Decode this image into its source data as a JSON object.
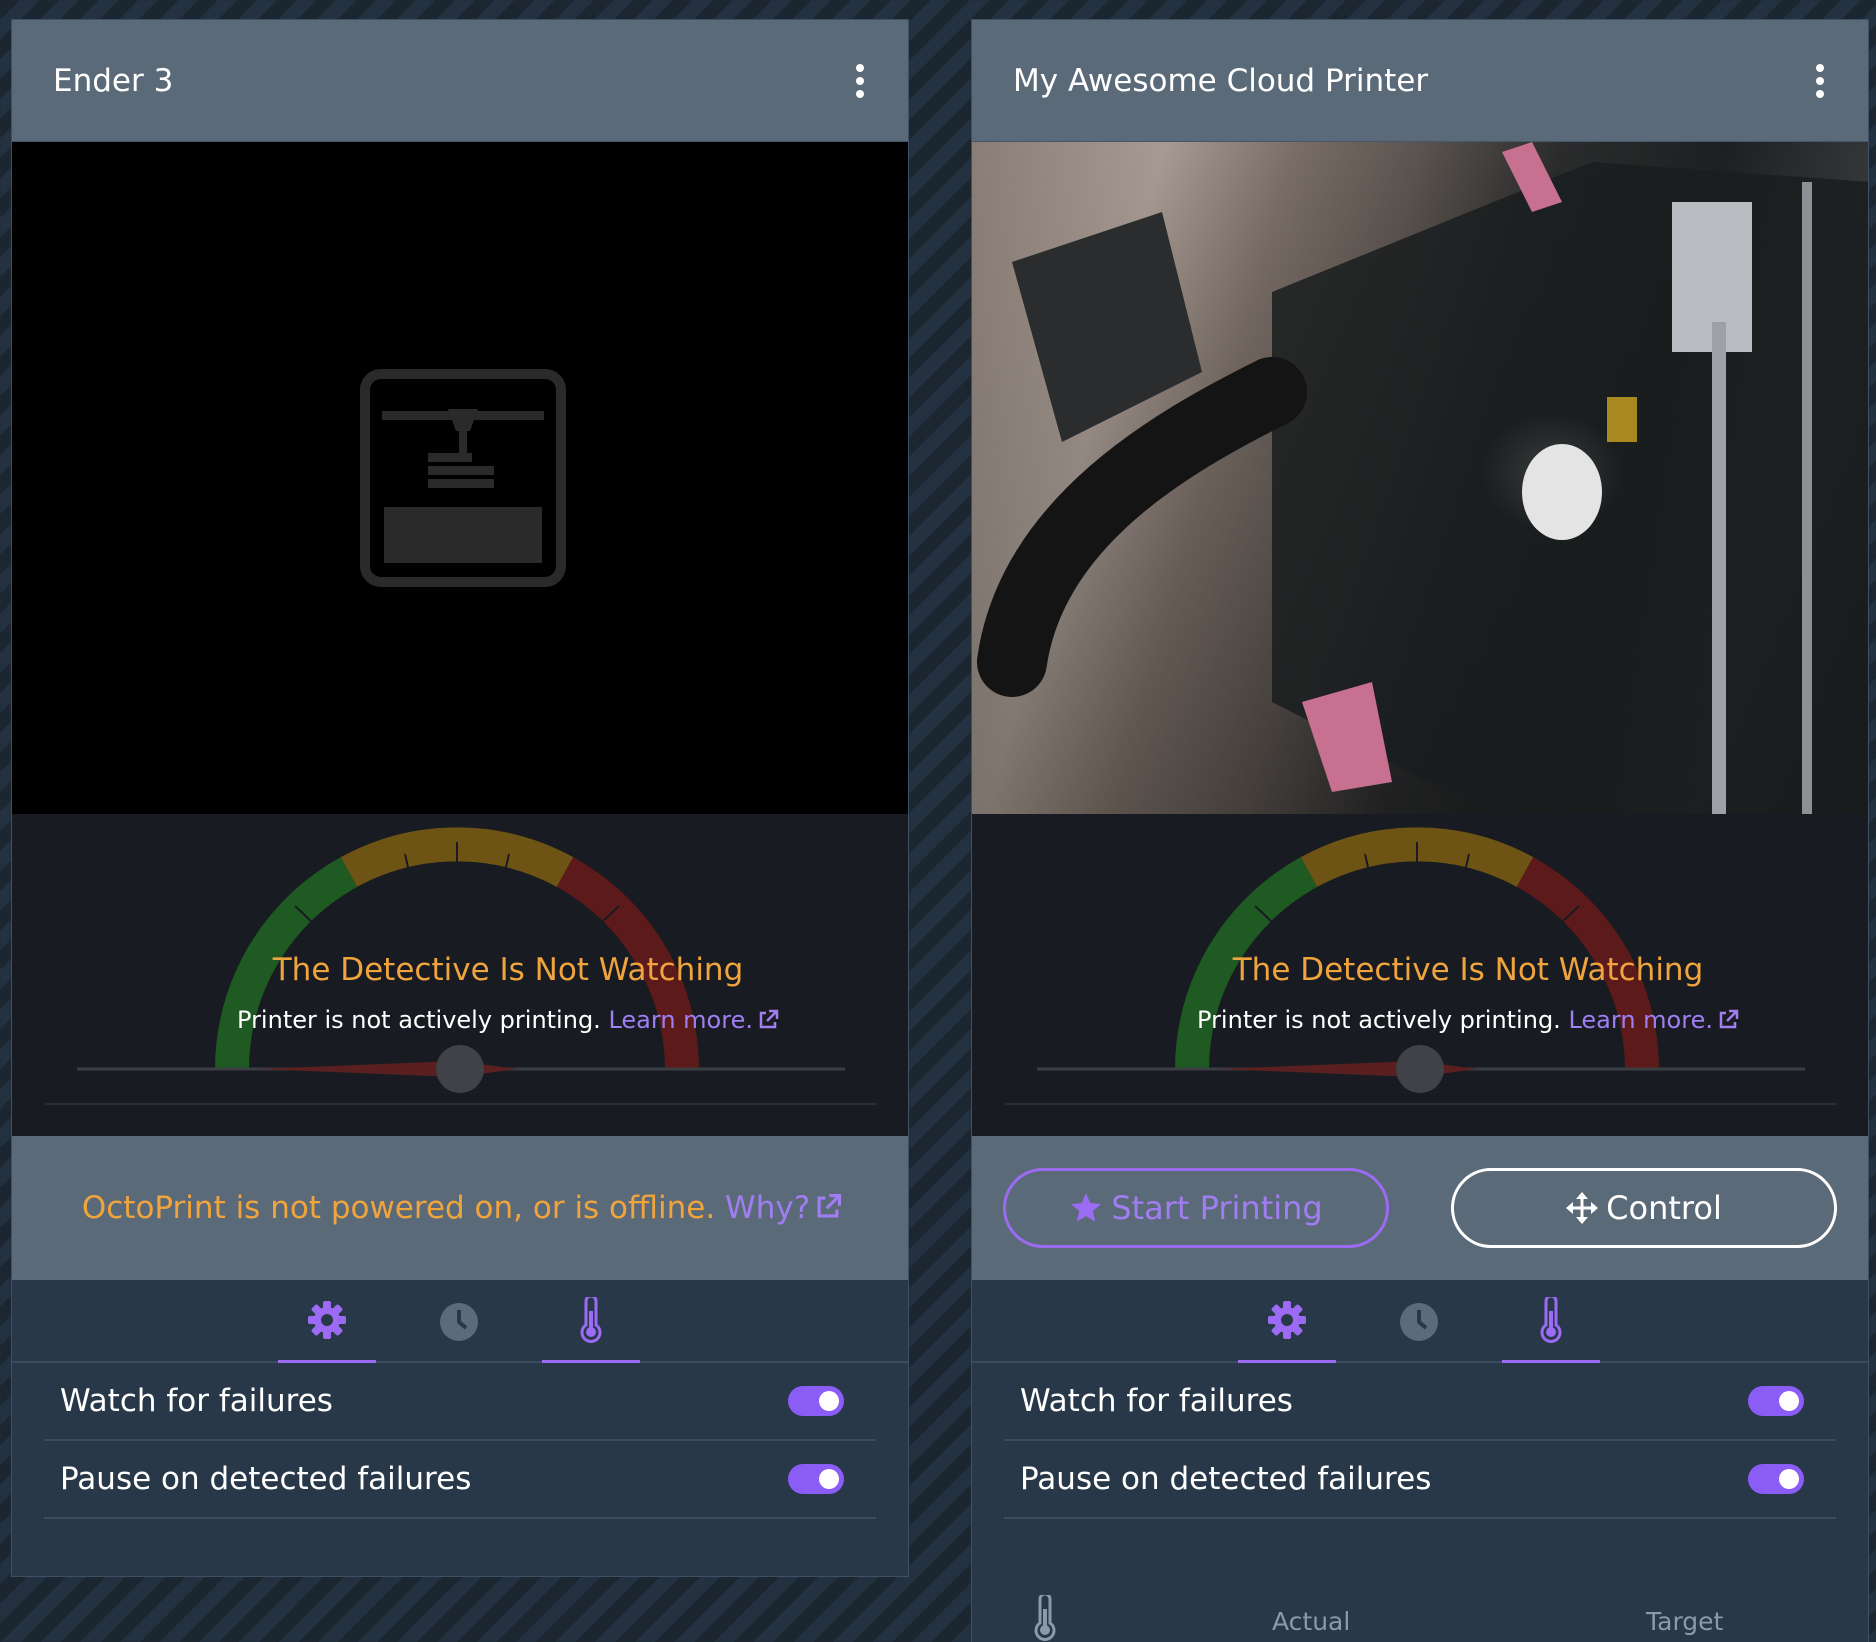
{
  "printers": [
    {
      "name": "Ender 3",
      "detective_title": "The Detective Is Not Watching",
      "detective_status": "Printer is not actively printing.",
      "learn_more": "Learn more.",
      "offline_message": "OctoPrint is not powered on, or is offline.",
      "offline_link": "Why?",
      "settings": [
        {
          "label": "Watch for failures",
          "enabled": true
        },
        {
          "label": "Pause on detected failures",
          "enabled": true
        }
      ]
    },
    {
      "name": "My Awesome Cloud Printer",
      "detective_title": "The Detective Is Not Watching",
      "detective_status": "Printer is not actively printing.",
      "learn_more": "Learn more.",
      "start_button": "Start Printing",
      "control_button": "Control",
      "settings": [
        {
          "label": "Watch for failures",
          "enabled": true
        },
        {
          "label": "Pause on detected failures",
          "enabled": true
        }
      ],
      "temperature_headers": {
        "actual": "Actual",
        "target": "Target"
      }
    }
  ],
  "tabs": [
    "gear-icon",
    "clock-icon",
    "thermometer-icon"
  ],
  "colors": {
    "accent": "#9b6cf3",
    "warning": "#f0a43d",
    "header": "#5b6a78",
    "card": "#283848"
  }
}
